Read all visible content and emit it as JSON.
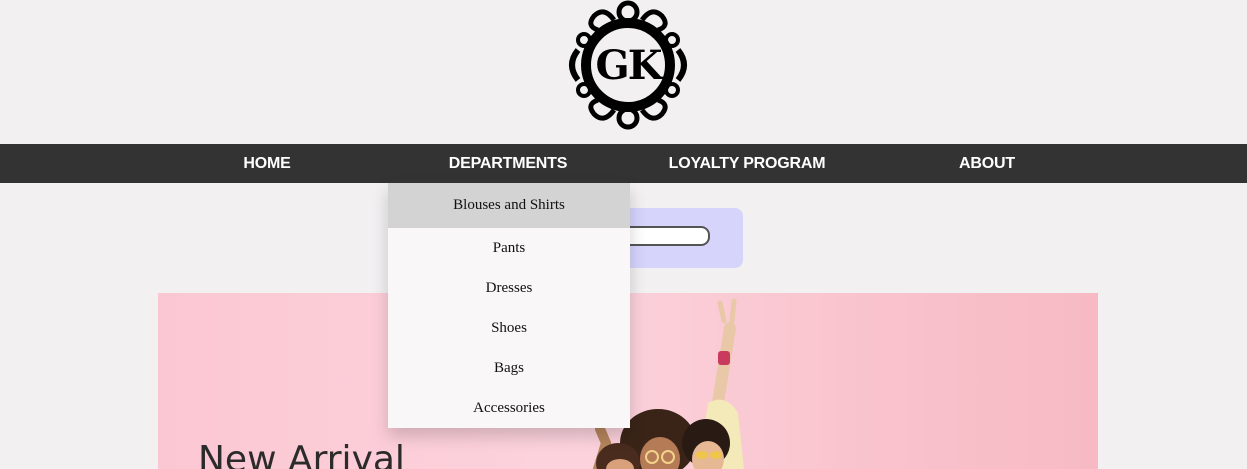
{
  "logo": {
    "text": "GK",
    "icon": "gk-ornamental-logo"
  },
  "nav": {
    "items": [
      {
        "label": "HOME"
      },
      {
        "label": "DEPARTMENTS"
      },
      {
        "label": "LOYALTY PROGRAM"
      },
      {
        "label": "ABOUT"
      }
    ]
  },
  "dropdown": {
    "items": [
      {
        "label": "Blouses and Shirts",
        "hovered": true
      },
      {
        "label": "Pants"
      },
      {
        "label": "Dresses"
      },
      {
        "label": "Shoes"
      },
      {
        "label": "Bags"
      },
      {
        "label": "Accessories"
      }
    ]
  },
  "search": {
    "value": "",
    "placeholder": ""
  },
  "hero": {
    "title": "New Arrival"
  },
  "colors": {
    "navbar": "#333333",
    "page_bg": "#f2f0f1",
    "search_bg": "#d6d4fb",
    "hero_bg": "#fbc7d2",
    "dropdown_hover": "#d3d3d3"
  }
}
